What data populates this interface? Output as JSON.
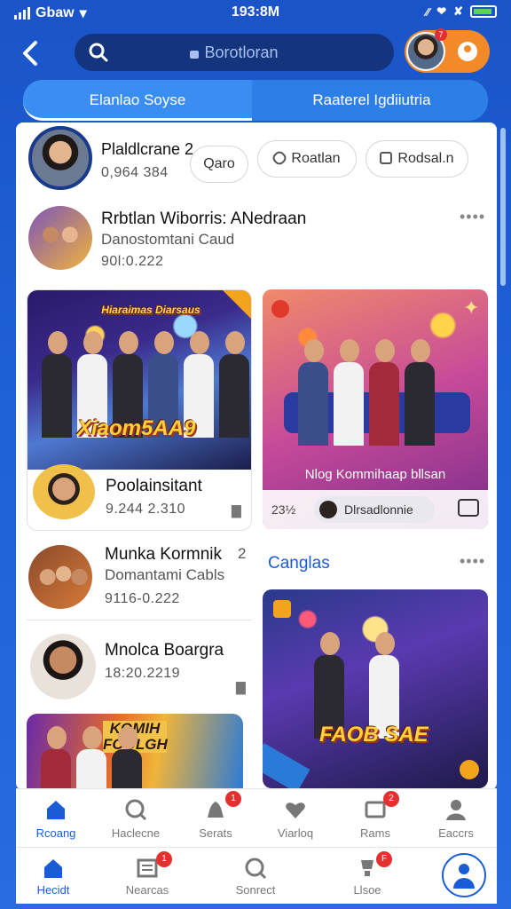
{
  "status_bar": {
    "carrier": "Gbaw",
    "time": "193:8M"
  },
  "search": {
    "placeholder": "Borotloran"
  },
  "header": {
    "profile_badge": "7"
  },
  "tabs": [
    {
      "label": "Elanlao Soyse"
    },
    {
      "label": "Raaterel Igdiiutria"
    }
  ],
  "feed": {
    "profile": {
      "name": "Plaldlcrane 2",
      "meta": "0,964 384"
    },
    "chips": [
      {
        "label": "Qaro"
      },
      {
        "label": "Roatlan"
      },
      {
        "label": "Rodsal.n"
      }
    ],
    "post1": {
      "title": "Rrbtlan Wiborris: ANedraan",
      "subtitle": "Danostomtani Caud",
      "meta": "90l:0.222"
    },
    "card_left": {
      "poster_top": "Hiaraimas Diarsaus",
      "poster_text": "Xiaom5AA9",
      "name": "Poolainsitant",
      "meta": "9.244 2.310"
    },
    "card_right": {
      "caption": "Nlog Kommihaap bllsan",
      "date": "23½",
      "pill_label": "Dlrsadlonnie"
    },
    "post2": {
      "title": "Munka Kormnik",
      "count": "2",
      "subtitle": "Domantami Cabls",
      "meta": "9116-0.222"
    },
    "section": {
      "title": "Canglas"
    },
    "post3": {
      "title": "Mnolca Boargra",
      "meta": "18:20.2219"
    },
    "card_right2": {
      "poster_text": "FAOB SAE"
    },
    "card_bottom": {
      "poster_text": "KOMIH FOOLGH"
    }
  },
  "tabbar_top": [
    {
      "label": "Rcoang",
      "active": true
    },
    {
      "label": "Haclecne"
    },
    {
      "label": "Serats",
      "badge": "1"
    },
    {
      "label": "Viarloq"
    },
    {
      "label": "Rams",
      "badge": "2"
    },
    {
      "label": "Eaccrs"
    }
  ],
  "tabbar_bottom": [
    {
      "label": "Hecidt",
      "active": true
    },
    {
      "label": "Nearcas",
      "badge": "1"
    },
    {
      "label": "Sonrect"
    },
    {
      "label": "Llsoe",
      "badge": "F"
    }
  ],
  "colors": {
    "primary": "#1a5cd6",
    "background": "#1f5fd6",
    "accent": "#f38a2a",
    "badge": "#e53030"
  }
}
